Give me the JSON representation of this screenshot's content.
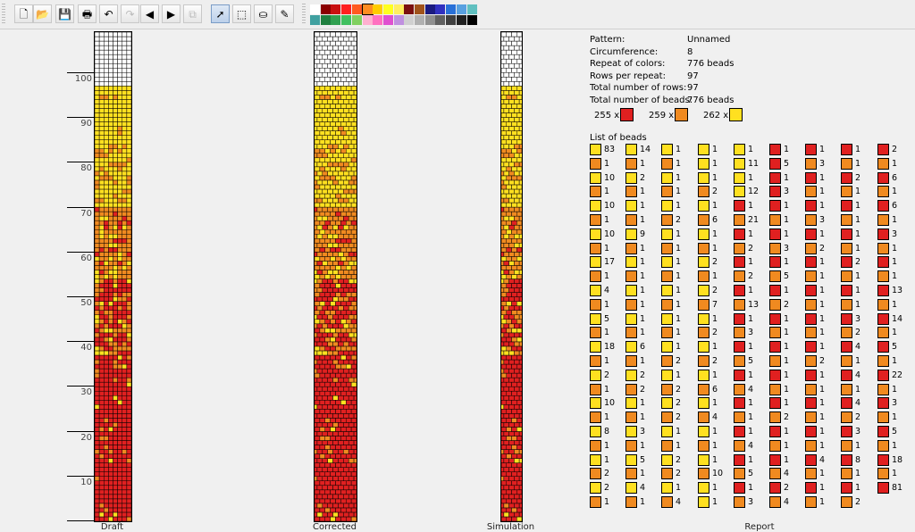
{
  "toolbar": {
    "buttons": [
      {
        "name": "new-file-icon",
        "glyph": "🗋"
      },
      {
        "name": "open-folder-icon",
        "glyph": "📂"
      },
      {
        "name": "save-icon",
        "glyph": "💾"
      },
      {
        "name": "print-icon",
        "glyph": "🖶"
      },
      {
        "name": "undo-icon",
        "glyph": "↶"
      },
      {
        "name": "redo-icon",
        "glyph": "↷"
      },
      {
        "name": "shift-left-icon",
        "glyph": "◀"
      },
      {
        "name": "shift-right-icon",
        "glyph": "▶"
      },
      {
        "name": "copy-icon",
        "glyph": "⧉"
      },
      {
        "name": "select-pointer-icon",
        "glyph": "➚"
      },
      {
        "name": "rectangle-select-icon",
        "glyph": "⬚"
      },
      {
        "name": "fill-bucket-icon",
        "glyph": "⛀"
      },
      {
        "name": "color-picker-icon",
        "glyph": "✎"
      }
    ],
    "palette_row1": [
      "#ffffff",
      "#8b0000",
      "#c81010",
      "#ff2020",
      "#ff5a20",
      "#ff8c20",
      "#ffcc00",
      "#ffff20",
      "#ffee60",
      "#7a1010",
      "#a0521a",
      "#1a1a80",
      "#3030c0",
      "#2870d8",
      "#58a0e0",
      "#60c0c0"
    ],
    "palette_row2": [
      "#40a0a0",
      "#208040",
      "#30a050",
      "#40c060",
      "#80d060",
      "#ffb0d0",
      "#ff70c0",
      "#e050d0",
      "#c090e0",
      "#d0d0d0",
      "#b0b0b0",
      "#909090",
      "#606060",
      "#404040",
      "#202020",
      "#000000"
    ]
  },
  "ruler": {
    "labels": [
      "100",
      "90",
      "80",
      "70",
      "60",
      "50",
      "40",
      "30",
      "20",
      "10"
    ]
  },
  "views": {
    "draft_label": "Draft",
    "corrected_label": "Corrected",
    "simulation_label": "Simulation",
    "report_label": "Report"
  },
  "pattern": {
    "circumference": 8,
    "rows": 97,
    "visible_rows": 109,
    "colors": {
      "red": "#e02020",
      "orange": "#f08a20",
      "yellow": "#ffe020",
      "empty": "#ffffff"
    }
  },
  "report": {
    "info": [
      {
        "k": "Pattern:",
        "v": "Unnamed"
      },
      {
        "k": "Circumference:",
        "v": "8"
      },
      {
        "k": "Repeat of colors:",
        "v": "776 beads"
      },
      {
        "k": "Rows per repeat:",
        "v": "97"
      },
      {
        "k": "Total number of rows:",
        "v": "97"
      },
      {
        "k": "Total number of beads:",
        "v": "776 beads"
      }
    ],
    "counts": [
      {
        "label": "255 x",
        "color": "red"
      },
      {
        "label": "259 x",
        "color": "orange"
      },
      {
        "label": "262 x",
        "color": "yellow"
      }
    ],
    "list_title": "List of beads",
    "columns": [
      [
        [
          "yellow",
          "83"
        ],
        [
          "orange",
          "1"
        ],
        [
          "yellow",
          "10"
        ],
        [
          "orange",
          "1"
        ],
        [
          "yellow",
          "10"
        ],
        [
          "orange",
          "1"
        ],
        [
          "yellow",
          "10"
        ],
        [
          "orange",
          "1"
        ],
        [
          "yellow",
          "17"
        ],
        [
          "orange",
          "1"
        ],
        [
          "yellow",
          "4"
        ],
        [
          "orange",
          "1"
        ],
        [
          "yellow",
          "5"
        ],
        [
          "orange",
          "1"
        ],
        [
          "yellow",
          "18"
        ],
        [
          "orange",
          "1"
        ],
        [
          "yellow",
          "2"
        ],
        [
          "orange",
          "1"
        ],
        [
          "yellow",
          "10"
        ],
        [
          "orange",
          "1"
        ],
        [
          "yellow",
          "8"
        ],
        [
          "orange",
          "1"
        ],
        [
          "yellow",
          "1"
        ],
        [
          "orange",
          "2"
        ],
        [
          "yellow",
          "2"
        ],
        [
          "orange",
          "1"
        ]
      ],
      [
        [
          "yellow",
          "14"
        ],
        [
          "orange",
          "1"
        ],
        [
          "yellow",
          "2"
        ],
        [
          "orange",
          "1"
        ],
        [
          "yellow",
          "1"
        ],
        [
          "orange",
          "1"
        ],
        [
          "yellow",
          "9"
        ],
        [
          "orange",
          "1"
        ],
        [
          "yellow",
          "1"
        ],
        [
          "orange",
          "1"
        ],
        [
          "yellow",
          "1"
        ],
        [
          "orange",
          "1"
        ],
        [
          "yellow",
          "1"
        ],
        [
          "orange",
          "1"
        ],
        [
          "yellow",
          "6"
        ],
        [
          "orange",
          "1"
        ],
        [
          "yellow",
          "2"
        ],
        [
          "orange",
          "2"
        ],
        [
          "yellow",
          "1"
        ],
        [
          "orange",
          "1"
        ],
        [
          "yellow",
          "3"
        ],
        [
          "orange",
          "1"
        ],
        [
          "yellow",
          "5"
        ],
        [
          "orange",
          "1"
        ],
        [
          "yellow",
          "4"
        ],
        [
          "orange",
          "1"
        ]
      ],
      [
        [
          "yellow",
          "1"
        ],
        [
          "orange",
          "1"
        ],
        [
          "yellow",
          "1"
        ],
        [
          "orange",
          "1"
        ],
        [
          "yellow",
          "1"
        ],
        [
          "orange",
          "2"
        ],
        [
          "yellow",
          "1"
        ],
        [
          "orange",
          "1"
        ],
        [
          "yellow",
          "1"
        ],
        [
          "orange",
          "1"
        ],
        [
          "yellow",
          "1"
        ],
        [
          "orange",
          "1"
        ],
        [
          "yellow",
          "1"
        ],
        [
          "orange",
          "1"
        ],
        [
          "yellow",
          "1"
        ],
        [
          "orange",
          "2"
        ],
        [
          "yellow",
          "1"
        ],
        [
          "orange",
          "2"
        ],
        [
          "yellow",
          "2"
        ],
        [
          "orange",
          "2"
        ],
        [
          "yellow",
          "1"
        ],
        [
          "orange",
          "1"
        ],
        [
          "yellow",
          "2"
        ],
        [
          "orange",
          "2"
        ],
        [
          "yellow",
          "1"
        ],
        [
          "orange",
          "4"
        ]
      ],
      [
        [
          "yellow",
          "1"
        ],
        [
          "yellow",
          "1"
        ],
        [
          "yellow",
          "1"
        ],
        [
          "orange",
          "2"
        ],
        [
          "yellow",
          "1"
        ],
        [
          "orange",
          "6"
        ],
        [
          "yellow",
          "1"
        ],
        [
          "orange",
          "1"
        ],
        [
          "yellow",
          "2"
        ],
        [
          "orange",
          "1"
        ],
        [
          "yellow",
          "2"
        ],
        [
          "orange",
          "7"
        ],
        [
          "yellow",
          "1"
        ],
        [
          "orange",
          "2"
        ],
        [
          "yellow",
          "1"
        ],
        [
          "orange",
          "2"
        ],
        [
          "yellow",
          "1"
        ],
        [
          "orange",
          "6"
        ],
        [
          "yellow",
          "1"
        ],
        [
          "orange",
          "4"
        ],
        [
          "yellow",
          "1"
        ],
        [
          "orange",
          "1"
        ],
        [
          "yellow",
          "1"
        ],
        [
          "orange",
          "10"
        ],
        [
          "yellow",
          "1"
        ],
        [
          "yellow",
          "1"
        ]
      ],
      [
        [
          "yellow",
          "1"
        ],
        [
          "yellow",
          "11"
        ],
        [
          "yellow",
          "1"
        ],
        [
          "yellow",
          "12"
        ],
        [
          "red",
          "1"
        ],
        [
          "orange",
          "21"
        ],
        [
          "red",
          "1"
        ],
        [
          "orange",
          "2"
        ],
        [
          "red",
          "1"
        ],
        [
          "orange",
          "2"
        ],
        [
          "red",
          "1"
        ],
        [
          "orange",
          "13"
        ],
        [
          "red",
          "1"
        ],
        [
          "orange",
          "3"
        ],
        [
          "red",
          "1"
        ],
        [
          "orange",
          "5"
        ],
        [
          "red",
          "1"
        ],
        [
          "orange",
          "4"
        ],
        [
          "red",
          "1"
        ],
        [
          "orange",
          "1"
        ],
        [
          "red",
          "1"
        ],
        [
          "orange",
          "4"
        ],
        [
          "red",
          "1"
        ],
        [
          "orange",
          "5"
        ],
        [
          "red",
          "1"
        ],
        [
          "orange",
          "3"
        ]
      ],
      [
        [
          "red",
          "1"
        ],
        [
          "red",
          "5"
        ],
        [
          "red",
          "1"
        ],
        [
          "red",
          "3"
        ],
        [
          "red",
          "1"
        ],
        [
          "orange",
          "1"
        ],
        [
          "red",
          "1"
        ],
        [
          "orange",
          "3"
        ],
        [
          "red",
          "1"
        ],
        [
          "orange",
          "5"
        ],
        [
          "red",
          "1"
        ],
        [
          "orange",
          "2"
        ],
        [
          "red",
          "1"
        ],
        [
          "orange",
          "1"
        ],
        [
          "red",
          "1"
        ],
        [
          "orange",
          "1"
        ],
        [
          "red",
          "1"
        ],
        [
          "orange",
          "1"
        ],
        [
          "red",
          "1"
        ],
        [
          "orange",
          "2"
        ],
        [
          "red",
          "1"
        ],
        [
          "orange",
          "1"
        ],
        [
          "red",
          "1"
        ],
        [
          "orange",
          "4"
        ],
        [
          "red",
          "2"
        ],
        [
          "orange",
          "4"
        ]
      ],
      [
        [
          "red",
          "1"
        ],
        [
          "orange",
          "3"
        ],
        [
          "red",
          "1"
        ],
        [
          "orange",
          "1"
        ],
        [
          "red",
          "1"
        ],
        [
          "orange",
          "3"
        ],
        [
          "red",
          "1"
        ],
        [
          "orange",
          "2"
        ],
        [
          "red",
          "1"
        ],
        [
          "orange",
          "1"
        ],
        [
          "red",
          "1"
        ],
        [
          "orange",
          "1"
        ],
        [
          "red",
          "1"
        ],
        [
          "orange",
          "1"
        ],
        [
          "red",
          "1"
        ],
        [
          "orange",
          "2"
        ],
        [
          "red",
          "1"
        ],
        [
          "orange",
          "1"
        ],
        [
          "red",
          "1"
        ],
        [
          "orange",
          "1"
        ],
        [
          "red",
          "1"
        ],
        [
          "orange",
          "1"
        ],
        [
          "red",
          "4"
        ],
        [
          "orange",
          "1"
        ],
        [
          "red",
          "1"
        ],
        [
          "orange",
          "1"
        ]
      ],
      [
        [
          "red",
          "1"
        ],
        [
          "orange",
          "1"
        ],
        [
          "red",
          "2"
        ],
        [
          "orange",
          "1"
        ],
        [
          "red",
          "1"
        ],
        [
          "orange",
          "1"
        ],
        [
          "red",
          "1"
        ],
        [
          "orange",
          "1"
        ],
        [
          "red",
          "2"
        ],
        [
          "orange",
          "1"
        ],
        [
          "red",
          "1"
        ],
        [
          "orange",
          "1"
        ],
        [
          "red",
          "3"
        ],
        [
          "orange",
          "2"
        ],
        [
          "red",
          "4"
        ],
        [
          "orange",
          "1"
        ],
        [
          "red",
          "4"
        ],
        [
          "orange",
          "1"
        ],
        [
          "red",
          "4"
        ],
        [
          "orange",
          "2"
        ],
        [
          "red",
          "3"
        ],
        [
          "orange",
          "1"
        ],
        [
          "red",
          "8"
        ],
        [
          "orange",
          "1"
        ],
        [
          "red",
          "1"
        ],
        [
          "orange",
          "2"
        ]
      ],
      [
        [
          "red",
          "2"
        ],
        [
          "orange",
          "1"
        ],
        [
          "red",
          "6"
        ],
        [
          "orange",
          "1"
        ],
        [
          "red",
          "6"
        ],
        [
          "orange",
          "1"
        ],
        [
          "red",
          "3"
        ],
        [
          "orange",
          "1"
        ],
        [
          "red",
          "1"
        ],
        [
          "orange",
          "1"
        ],
        [
          "red",
          "13"
        ],
        [
          "orange",
          "1"
        ],
        [
          "red",
          "14"
        ],
        [
          "orange",
          "1"
        ],
        [
          "red",
          "5"
        ],
        [
          "orange",
          "1"
        ],
        [
          "red",
          "22"
        ],
        [
          "orange",
          "1"
        ],
        [
          "red",
          "3"
        ],
        [
          "orange",
          "1"
        ],
        [
          "red",
          "5"
        ],
        [
          "orange",
          "1"
        ],
        [
          "red",
          "18"
        ],
        [
          "orange",
          "1"
        ],
        [
          "red",
          "81"
        ]
      ]
    ]
  }
}
